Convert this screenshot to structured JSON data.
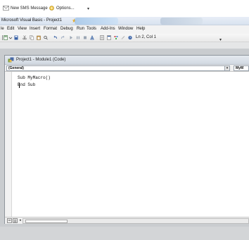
{
  "sms_bar": {
    "new_sms": "New SMS Message",
    "options": "Options...",
    "chevron": "▾"
  },
  "title_bar": {
    "title": "Microsoft Visual Basic - Project1"
  },
  "menu": {
    "items": [
      "le",
      "Edit",
      "View",
      "Insert",
      "Format",
      "Debug",
      "Run",
      "Tools",
      "Add-Ins",
      "Window",
      "Help"
    ]
  },
  "toolbar": {
    "position": "Ln 2, Col 1",
    "chevron": "▾"
  },
  "code_window": {
    "title": "Project1 - Module1 (Code)",
    "object_combo": "(General)",
    "object_combo_arrow": "▾",
    "proc_combo": "MyM",
    "lines": [
      "Sub MyMacro()",
      "",
      "End Sub"
    ]
  },
  "colors": {
    "titlebar": "#dfe7f2",
    "mdi_background": "#c9cccf",
    "code_background": "#ffffff"
  }
}
